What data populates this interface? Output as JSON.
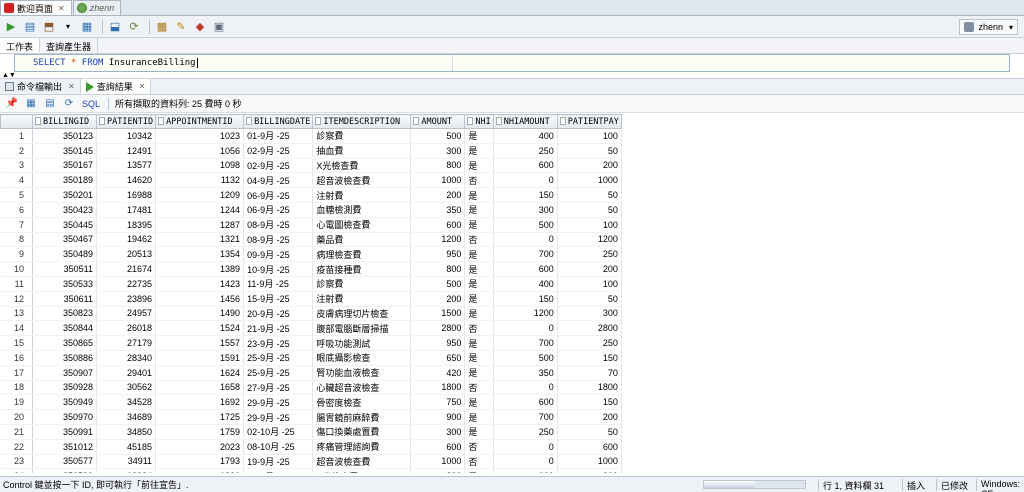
{
  "tabs": [
    {
      "label": "歡迎頁面"
    },
    {
      "label": "zhenn"
    }
  ],
  "toolbar": {
    "user": "zhenn"
  },
  "subtabs": [
    "工作表",
    "查詢產生器"
  ],
  "editor": {
    "kw_select": "SELECT",
    "star": "*",
    "kw_from": "FROM",
    "table": "InsuranceBilling"
  },
  "result_tabs": [
    {
      "label": "命令檔輸出"
    },
    {
      "label": "查詢結果"
    }
  ],
  "result_toolbar": {
    "sql_label": "SQL",
    "status": "所有擷取的資料列: 25 費時 0 秒"
  },
  "grid": {
    "columns": [
      "BILLINGID",
      "PATIENTID",
      "APPOINTMENTID",
      "BILLINGDATE",
      "ITEMDESCRIPTION",
      "AMOUNT",
      "NHI",
      "NHIAMOUNT",
      "PATIENTPAY"
    ],
    "rows": [
      [
        "1",
        "350123",
        "10342",
        "1023",
        "01-9月 -25",
        "診察費",
        "500",
        "是",
        "400",
        "100"
      ],
      [
        "2",
        "350145",
        "12491",
        "1056",
        "02-9月 -25",
        "抽血費",
        "300",
        "是",
        "250",
        "50"
      ],
      [
        "3",
        "350167",
        "13577",
        "1098",
        "02-9月 -25",
        "X光檢查費",
        "800",
        "是",
        "600",
        "200"
      ],
      [
        "4",
        "350189",
        "14620",
        "1132",
        "04-9月 -25",
        "超音波檢查費",
        "1000",
        "否",
        "0",
        "1000"
      ],
      [
        "5",
        "350201",
        "16988",
        "1209",
        "06-9月 -25",
        "注射費",
        "200",
        "是",
        "150",
        "50"
      ],
      [
        "6",
        "350423",
        "17481",
        "1244",
        "06-9月 -25",
        "血糖檢測費",
        "350",
        "是",
        "300",
        "50"
      ],
      [
        "7",
        "350445",
        "18395",
        "1287",
        "08-9月 -25",
        "心電圖檢查費",
        "600",
        "是",
        "500",
        "100"
      ],
      [
        "8",
        "350467",
        "19462",
        "1321",
        "08-9月 -25",
        "藥品費",
        "1200",
        "否",
        "0",
        "1200"
      ],
      [
        "9",
        "350489",
        "20513",
        "1354",
        "09-9月 -25",
        "病理檢查費",
        "950",
        "是",
        "700",
        "250"
      ],
      [
        "10",
        "350511",
        "21674",
        "1389",
        "10-9月 -25",
        "疫苗接種費",
        "800",
        "是",
        "600",
        "200"
      ],
      [
        "11",
        "350533",
        "22735",
        "1423",
        "11-9月 -25",
        "診察費",
        "500",
        "是",
        "400",
        "100"
      ],
      [
        "12",
        "350611",
        "23896",
        "1456",
        "15-9月 -25",
        "注射費",
        "200",
        "是",
        "150",
        "50"
      ],
      [
        "13",
        "350823",
        "24957",
        "1490",
        "20-9月 -25",
        "皮膚病理切片檢查",
        "1500",
        "是",
        "1200",
        "300"
      ],
      [
        "14",
        "350844",
        "26018",
        "1524",
        "21-9月 -25",
        "腹部電腦斷層掃描",
        "2800",
        "否",
        "0",
        "2800"
      ],
      [
        "15",
        "350865",
        "27179",
        "1557",
        "23-9月 -25",
        "呼吸功能測試",
        "950",
        "是",
        "700",
        "250"
      ],
      [
        "16",
        "350886",
        "28340",
        "1591",
        "25-9月 -25",
        "眼底攝影檢查",
        "650",
        "是",
        "500",
        "150"
      ],
      [
        "17",
        "350907",
        "29401",
        "1624",
        "25-9月 -25",
        "腎功能血液檢查",
        "420",
        "是",
        "350",
        "70"
      ],
      [
        "18",
        "350928",
        "30562",
        "1658",
        "27-9月 -25",
        "心臟超音波檢查",
        "1800",
        "否",
        "0",
        "1800"
      ],
      [
        "19",
        "350949",
        "34528",
        "1692",
        "29-9月 -25",
        "骨密度檢查",
        "750",
        "是",
        "600",
        "150"
      ],
      [
        "20",
        "350970",
        "34689",
        "1725",
        "29-9月 -25",
        "腸胃鏡前麻醉費",
        "900",
        "是",
        "700",
        "200"
      ],
      [
        "21",
        "350991",
        "34850",
        "1759",
        "02-10月 -25",
        "傷口換藥處置費",
        "300",
        "是",
        "250",
        "50"
      ],
      [
        "22",
        "351012",
        "45185",
        "2023",
        "08-10月 -25",
        "疼痛管理諮詢費",
        "600",
        "否",
        "0",
        "600"
      ],
      [
        "23",
        "350577",
        "34911",
        "1793",
        "19-9月 -25",
        "超音波檢查費",
        "1000",
        "否",
        "0",
        "1000"
      ],
      [
        "24",
        "350599",
        "13284",
        "1826",
        "28-9月 -25",
        "X光檢查費",
        "800",
        "是",
        "600",
        "200"
      ]
    ]
  },
  "status": {
    "message": "Control 鍵並按一下 ID, 即可執行「前往宣告」.",
    "position": "行 1, 資料欄 31",
    "mode": "插入",
    "modified": "已修改",
    "eol": "Windows: CF",
    "progress": 0.5
  }
}
